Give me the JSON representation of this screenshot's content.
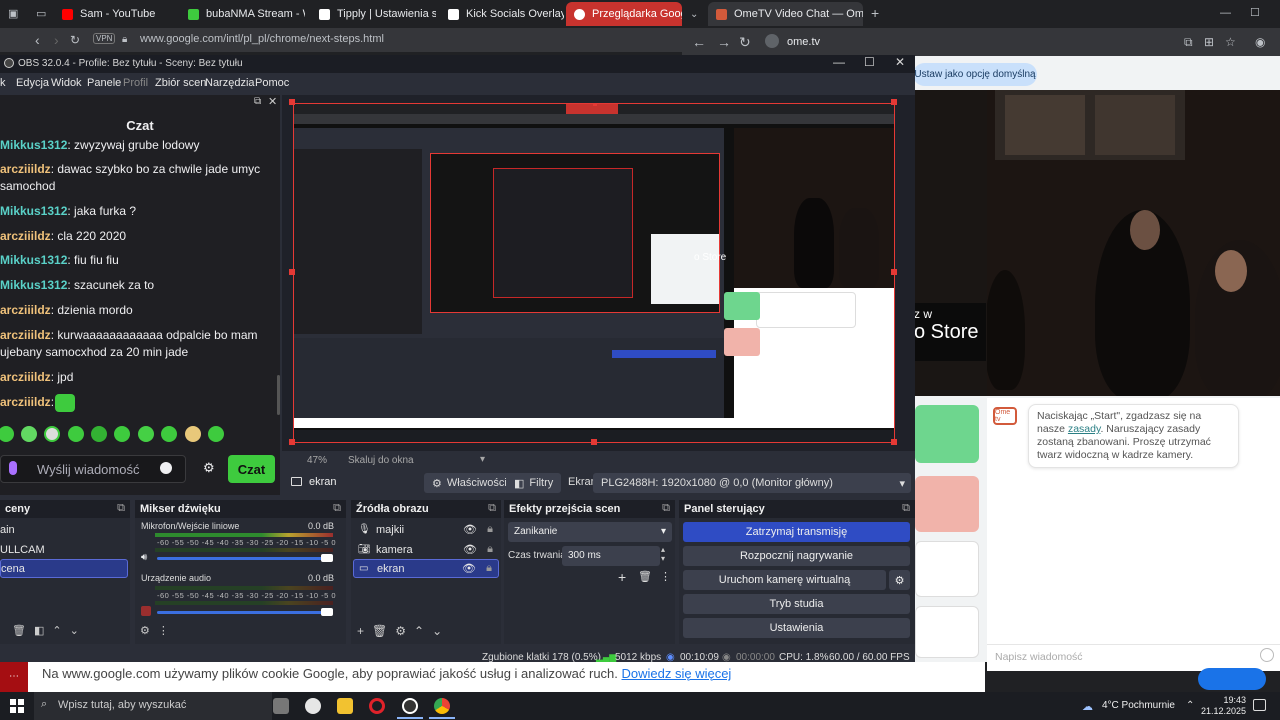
{
  "browser": {
    "tabs": [
      {
        "label": "Sam - YouTube",
        "color": "#ff0000"
      },
      {
        "label": "bubaNMA Stream - Watc",
        "color": "#3ecb3e"
      },
      {
        "label": "Tipply | Ustawienia strony",
        "color": "#ffffff"
      },
      {
        "label": "Kick Socials Overlay Gen",
        "color": "#ffffff"
      },
      {
        "label": "Przeglądarka Google Ch",
        "color": "#ffffff"
      },
      {
        "label": "OmeTV Video Chat — Ome",
        "color": "#d25a3b"
      }
    ],
    "left_url": "www.google.com/intl/pl_pl/chrome/next-steps.html",
    "left_vpn": "VPN",
    "right_url": "ome.tv"
  },
  "ome": {
    "default_button": "Ustaw jako opcję domyślną",
    "store_text": "o Store",
    "store_prefix": "z w",
    "logo_text": "Ome tv",
    "bubble_pre": "Naciskając „Start\", zgadzasz się na nasze ",
    "bubble_link": "zasady",
    "bubble_post": ". Naruszający zasady zostaną zbanowani. Proszę utrzymać twarz widoczną w kadrze kamery.",
    "message_placeholder": "Napisz wiadomość"
  },
  "obs": {
    "title": "OBS 32.0.4 - Profile: Bez tytułu - Sceny: Bez tytułu",
    "menu": [
      "k",
      "Edycja",
      "Widok",
      "Panele",
      "Profil",
      "Zbiór scen",
      "Narzędzia",
      "Pomoc"
    ],
    "chat": {
      "header": "Czat",
      "lines": [
        {
          "user": "Mikkus1312",
          "text": ": zwyzywaj grube lodowy",
          "color": "#5ad1c8"
        },
        {
          "user": "arcziiildz",
          "text": ": dawac szybko bo za chwile jade umyc",
          "color": "#f0c27b"
        },
        {
          "user": "",
          "text": "samochod",
          "color": "#efeff1"
        },
        {
          "user": "Mikkus1312",
          "text": ": jaka furka ?",
          "color": "#5ad1c8"
        },
        {
          "user": "arcziiildz",
          "text": ": cla 220 2020",
          "color": "#f0c27b"
        },
        {
          "user": "Mikkus1312",
          "text": ": fiu fiu fiu",
          "color": "#5ad1c8"
        },
        {
          "user": "Mikkus1312",
          "text": ": szacunek za to",
          "color": "#5ad1c8"
        },
        {
          "user": "arcziiildz",
          "text": ": dzienia mordo",
          "color": "#f0c27b"
        },
        {
          "user": "arcziiildz",
          "text": ": kurwaaaaaaaaaaaa odpalcie bo mam",
          "color": "#f0c27b"
        },
        {
          "user": "",
          "text": "ujebany samocxhod za 20 min jade",
          "color": "#efeff1"
        },
        {
          "user": "arcziiildz",
          "text": ": jpd",
          "color": "#f0c27b"
        },
        {
          "user": "arcziiildz",
          "text": ":",
          "color": "#f0c27b"
        }
      ],
      "input_placeholder": "Wyślij wiadomość",
      "send_label": "Czat"
    },
    "preview_zoom": "47%",
    "preview_scale": "Skaluj do okna",
    "source_name": "ekran",
    "properties_label": "Właściwości",
    "filters_label": "Filtry",
    "screen_label": "Ekran",
    "screen_value": "PLG2488H: 1920x1080 @ 0,0 (Monitor główny)",
    "scenes": {
      "title": "ceny",
      "items": [
        "ain",
        "ULLCAM",
        "cena"
      ]
    },
    "mixer": {
      "title": "Mikser dźwięku",
      "channels": [
        {
          "name": "Mikrofon/Wejście liniowe",
          "db": "0.0 dB"
        },
        {
          "name": "Urządzenie audio",
          "db": "0.0 dB"
        }
      ],
      "scale": "-60 -55 -50 -45 -40 -35 -30 -25 -20 -15 -10 -5 0"
    },
    "sources": {
      "title": "Źródła obrazu",
      "items": [
        "majkii",
        "kamera",
        "ekran"
      ]
    },
    "transitions": {
      "title": "Efekty przejścia scen",
      "selected": "Zanikanie",
      "duration_label": "Czas trwania",
      "duration_value": "300 ms"
    },
    "controls": {
      "title": "Panel sterujący",
      "buttons": [
        "Zatrzymaj transmisję",
        "Rozpocznij nagrywanie",
        "Uruchom kamerę wirtualną",
        "Tryb studia",
        "Ustawienia"
      ]
    },
    "status": {
      "dropped": "Zgubione klatki 178 (0.5%)",
      "bitrate": "5012 kbps",
      "stream_time": "00:10:09",
      "rec_time": "00:00:00",
      "cpu": "CPU: 1.8%",
      "fps": "60.00 / 60.00 FPS"
    }
  },
  "cookie": {
    "text": "Na www.google.com używamy plików cookie Google, aby poprawiać jakość usług i analizować ruch. ",
    "link": "Dowiedz się więcej"
  },
  "taskbar": {
    "search": "Wpisz tutaj, aby wyszukać",
    "weather": "4°C  Pochmurnie",
    "time": "19:43",
    "date": "21.12.2025"
  }
}
